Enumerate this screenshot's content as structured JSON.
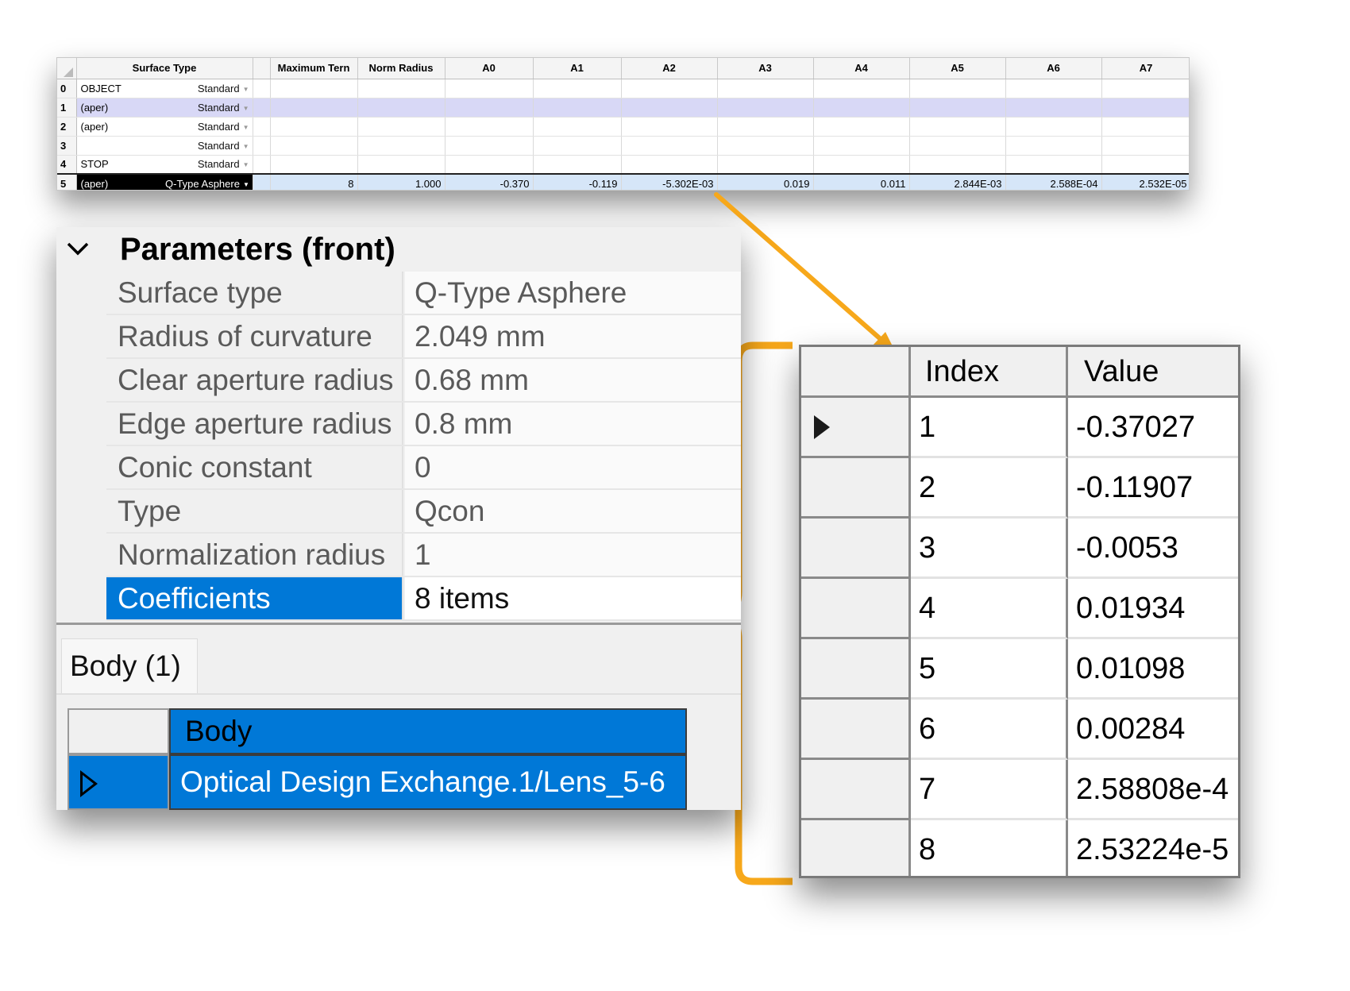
{
  "colors": {
    "accent_orange": "#F7A81B",
    "selection_blue": "#0078D7",
    "selected_row": "#D8D8F6",
    "active_cell": "#D6E6F8"
  },
  "lens_editor": {
    "headers": [
      "Surface Type",
      "Maximum Tern",
      "Norm Radius",
      "A0",
      "A1",
      "A2",
      "A3",
      "A4",
      "A5",
      "A6",
      "A7"
    ],
    "rows": [
      {
        "num": "0",
        "comment": "OBJECT",
        "type": "Standard",
        "values": [
          "",
          "",
          "",
          "",
          "",
          "",
          "",
          "",
          "",
          ""
        ]
      },
      {
        "num": "1",
        "comment": "(aper)",
        "type": "Standard",
        "values": [
          "",
          "",
          "",
          "",
          "",
          "",
          "",
          "",
          "",
          ""
        ]
      },
      {
        "num": "2",
        "comment": "(aper)",
        "type": "Standard",
        "values": [
          "",
          "",
          "",
          "",
          "",
          "",
          "",
          "",
          "",
          ""
        ]
      },
      {
        "num": "3",
        "comment": "",
        "type": "Standard",
        "values": [
          "",
          "",
          "",
          "",
          "",
          "",
          "",
          "",
          "",
          ""
        ]
      },
      {
        "num": "4",
        "comment": "STOP",
        "type": "Standard",
        "values": [
          "",
          "",
          "",
          "",
          "",
          "",
          "",
          "",
          "",
          ""
        ]
      },
      {
        "num": "5",
        "comment": "(aper)",
        "type": "Q-Type Asphere",
        "values": [
          "8",
          "1.000",
          "-0.370",
          "-0.119",
          "-5.302E-03",
          "0.019",
          "0.011",
          "2.844E-03",
          "2.588E-04",
          "2.532E-05"
        ]
      }
    ]
  },
  "params": {
    "title": "Parameters (front)",
    "rows": [
      {
        "name": "Surface type",
        "value": "Q-Type Asphere"
      },
      {
        "name": "Radius of curvature",
        "value": "2.049 mm"
      },
      {
        "name": "Clear aperture radius",
        "value": "0.68 mm"
      },
      {
        "name": "Edge aperture radius",
        "value": "0.8 mm"
      },
      {
        "name": "Conic constant",
        "value": "0"
      },
      {
        "name": "Type",
        "value": "Qcon"
      },
      {
        "name": "Normalization radius",
        "value": "1"
      },
      {
        "name": "Coefficients",
        "value": "8 items"
      }
    ]
  },
  "body_tab": {
    "label": "Body (1)"
  },
  "body_grid": {
    "header": "Body",
    "row": "Optical Design Exchange.1/Lens_5-6"
  },
  "coefficients": {
    "headers": [
      "Index",
      "Value"
    ],
    "rows": [
      {
        "index": "1",
        "value": "-0.37027"
      },
      {
        "index": "2",
        "value": "-0.11907"
      },
      {
        "index": "3",
        "value": "-0.0053"
      },
      {
        "index": "4",
        "value": "0.01934"
      },
      {
        "index": "5",
        "value": "0.01098"
      },
      {
        "index": "6",
        "value": "0.00284"
      },
      {
        "index": "7",
        "value": "2.58808e-4"
      },
      {
        "index": "8",
        "value": "2.53224e-5"
      }
    ]
  }
}
